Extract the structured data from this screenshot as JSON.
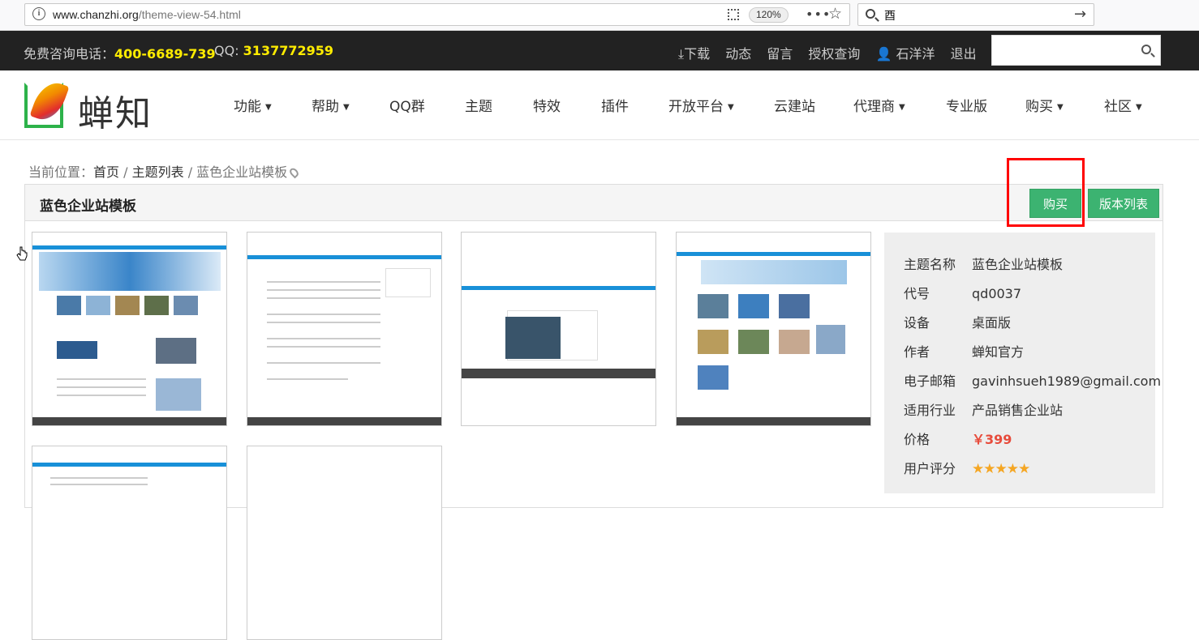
{
  "browser": {
    "url_host": "www.chanzhi.org",
    "url_path": "/theme-view-54.html",
    "zoom": "120%",
    "search_query": "酉"
  },
  "topbar": {
    "phone_label": "免费咨询电话：",
    "phone": "400-6689-739",
    "qq_label": "QQ:",
    "qq": "3137772959",
    "links": [
      "下载",
      "动态",
      "留言",
      "授权查询",
      "石洋洋",
      "退出"
    ]
  },
  "logo": {
    "text": "蝉知"
  },
  "nav": {
    "items": [
      {
        "label": "功能",
        "dropdown": true
      },
      {
        "label": "帮助",
        "dropdown": true
      },
      {
        "label": "QQ群",
        "dropdown": false
      },
      {
        "label": "主题",
        "dropdown": false
      },
      {
        "label": "特效",
        "dropdown": false
      },
      {
        "label": "插件",
        "dropdown": false
      },
      {
        "label": "开放平台",
        "dropdown": true
      },
      {
        "label": "云建站",
        "dropdown": false
      },
      {
        "label": "代理商",
        "dropdown": true
      },
      {
        "label": "专业版",
        "dropdown": false
      },
      {
        "label": "购买",
        "dropdown": true
      },
      {
        "label": "社区",
        "dropdown": true
      }
    ]
  },
  "breadcrumb": {
    "prefix": "当前位置：",
    "home": "首页",
    "list": "主题列表",
    "current": "蓝色企业站模板"
  },
  "panel": {
    "title": "蓝色企业站模板",
    "buy_label": "购买",
    "versions_label": "版本列表"
  },
  "info": {
    "rows": [
      {
        "key": "主题名称",
        "value": "蓝色企业站模板"
      },
      {
        "key": "代号",
        "value": "qd0037"
      },
      {
        "key": "设备",
        "value": "桌面版"
      },
      {
        "key": "作者",
        "value": "蝉知官方"
      },
      {
        "key": "电子邮箱",
        "value": "gavinhsueh1989@gmail.com"
      },
      {
        "key": "适用行业",
        "value": "产品销售企业站"
      }
    ],
    "price_key": "价格",
    "price": "￥399",
    "rating_key": "用户评分",
    "rating": "5",
    "rating_max": "5",
    "stars": "★★★★★"
  },
  "colors": {
    "accent_green": "#3cb371",
    "top_bar": "#222222",
    "highlight_yellow": "#ffec00",
    "price_red": "#e74c3c",
    "annotation_red": "#ff0000"
  }
}
